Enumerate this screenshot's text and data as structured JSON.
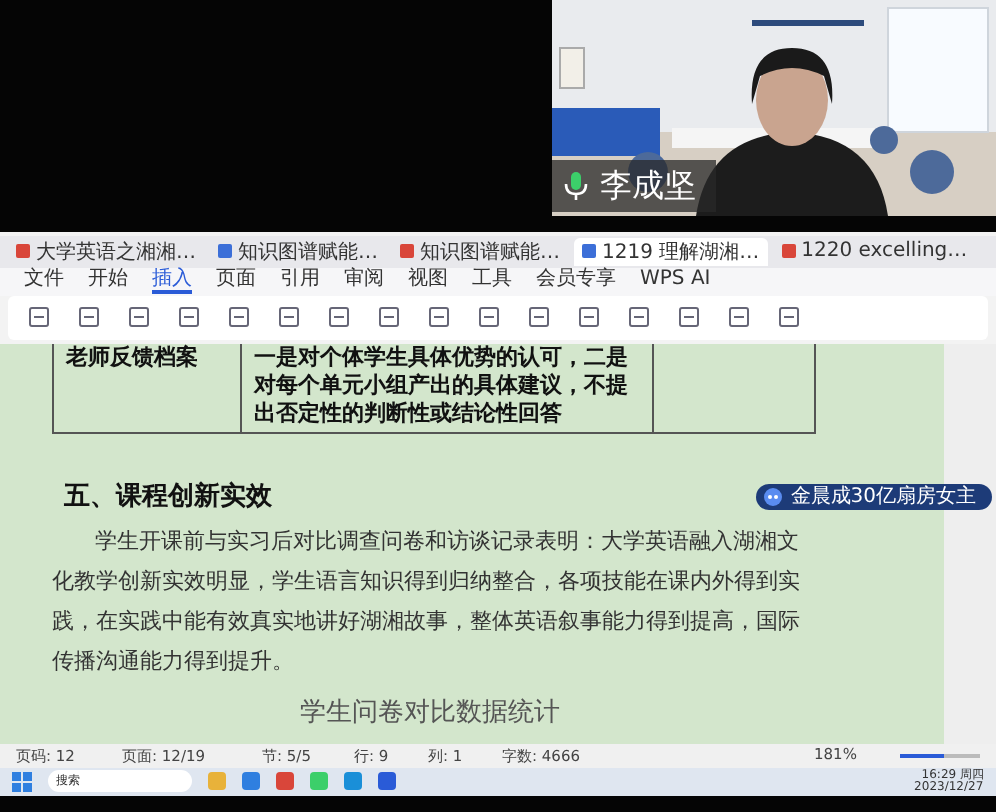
{
  "video": {
    "kind": "picture",
    "speaker": "李成坚",
    "mic_on": true
  },
  "tabs": [
    {
      "label": "大学英语之湘湘…",
      "selected": false,
      "color": "#d9463a"
    },
    {
      "label": "知识图谱赋能…",
      "selected": false,
      "color": "#3c6fd8"
    },
    {
      "label": "知识图谱赋能…",
      "selected": false,
      "color": "#d9463a"
    },
    {
      "label": "1219 理解湖湘…",
      "selected": true,
      "color": "#3c6fd8"
    },
    {
      "label": "1220 excelling…",
      "selected": false,
      "color": "#d9463a"
    }
  ],
  "menu": [
    {
      "label": "文件",
      "selected": false
    },
    {
      "label": "开始",
      "selected": false
    },
    {
      "label": "插入",
      "selected": true
    },
    {
      "label": "页面",
      "selected": false
    },
    {
      "label": "引用",
      "selected": false
    },
    {
      "label": "审阅",
      "selected": false
    },
    {
      "label": "视图",
      "selected": false
    },
    {
      "label": "工具",
      "selected": false
    },
    {
      "label": "会员专享",
      "selected": false
    },
    {
      "label": "WPS AI",
      "selected": false
    }
  ],
  "table_row": {
    "label": "老师反馈档案",
    "content": "一是对个体学生具体优势的认可，二是对每个单元小组产出的具体建议，不提出否定性的判断性或结论性回答"
  },
  "heading": "五、课程创新实效",
  "paragraph": "学生开课前与实习后对比调查问卷和访谈记录表明：大学英语融入湖湘文化教学创新实效明显，学生语言知识得到归纳整合，各项技能在课内外得到实践，在实践中能有效真实地讲好湖湘故事，整体英语叙事能力得到提高，国际传播沟通能力得到提升。",
  "caption": "学生问卷对比数据统计",
  "bubble": "金晨成30亿扇房女主",
  "status": [
    "页码: 12",
    "页面: 12/19",
    "节: 5/5",
    "行: 9",
    "列: 1",
    "字数: 4666"
  ],
  "zoom": {
    "reading": "181%",
    "level": 0.55
  },
  "taskbar": {
    "search": "搜索",
    "time": "16:29 周四",
    "date": "2023/12/27"
  }
}
